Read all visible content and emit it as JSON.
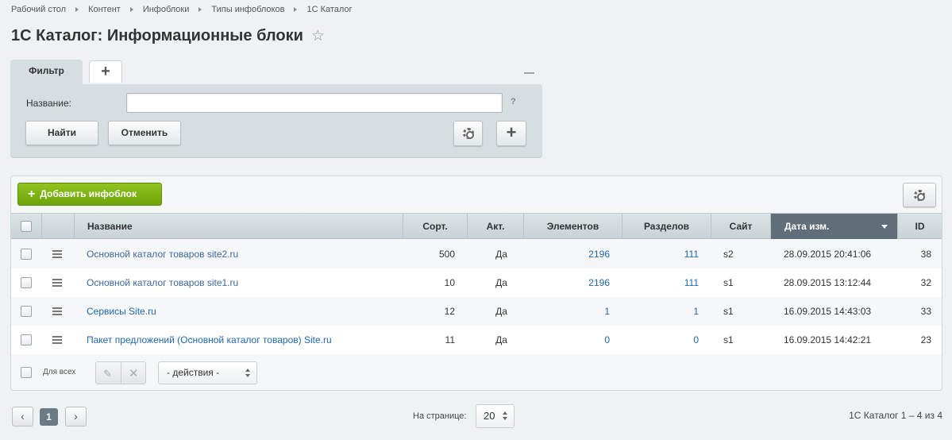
{
  "breadcrumb": [
    "Рабочий стол",
    "Контент",
    "Инфоблоки",
    "Типы инфоблоков",
    "1С Каталог"
  ],
  "page_title": "1С Каталог: Информационные блоки",
  "filter": {
    "tab_label": "Фильтр",
    "add_tab_label": "+",
    "name_label": "Название:",
    "name_value": "",
    "help_label": "?",
    "find_label": "Найти",
    "cancel_label": "Отменить",
    "plus_label": "+"
  },
  "toolbar": {
    "add_label": "Добавить инфоблок"
  },
  "table": {
    "columns": [
      "Название",
      "Сорт.",
      "Акт.",
      "Элементов",
      "Разделов",
      "Сайт",
      "Дата изм.",
      "ID"
    ],
    "sorted_column": "Дата изм.",
    "rows": [
      {
        "name": "Основной каталог товаров site2.ru",
        "sort": "500",
        "active": "Да",
        "elements": "2196",
        "sections": "111",
        "site": "s2",
        "date": "28.09.2015 20:41:06",
        "id": "38"
      },
      {
        "name": "Основной каталог товаров site1.ru",
        "sort": "10",
        "active": "Да",
        "elements": "2196",
        "sections": "111",
        "site": "s1",
        "date": "28.09.2015 13:12:44",
        "id": "32"
      },
      {
        "name": "Сервисы Site.ru",
        "sort": "12",
        "active": "Да",
        "elements": "1",
        "sections": "1",
        "site": "s1",
        "date": "16.09.2015 14:43:03",
        "id": "33"
      },
      {
        "name": "Пакет предложений (Основной каталог товаров) Site.ru",
        "sort": "11",
        "active": "Да",
        "elements": "0",
        "sections": "0",
        "site": "s1",
        "date": "16.09.2015 14:42:21",
        "id": "23"
      }
    ]
  },
  "footer": {
    "for_all_label": "Для всех",
    "actions_select": "- действия -"
  },
  "pagination": {
    "prev": "‹",
    "next": "›",
    "current_page": "1",
    "per_page_label": "На странице:",
    "per_page_value": "20",
    "summary": "1С Каталог 1 – 4 из 4"
  },
  "colors": {
    "accent_green": "#7ab317",
    "sorted_header": "#5f6e78",
    "link": "#2067b0"
  }
}
